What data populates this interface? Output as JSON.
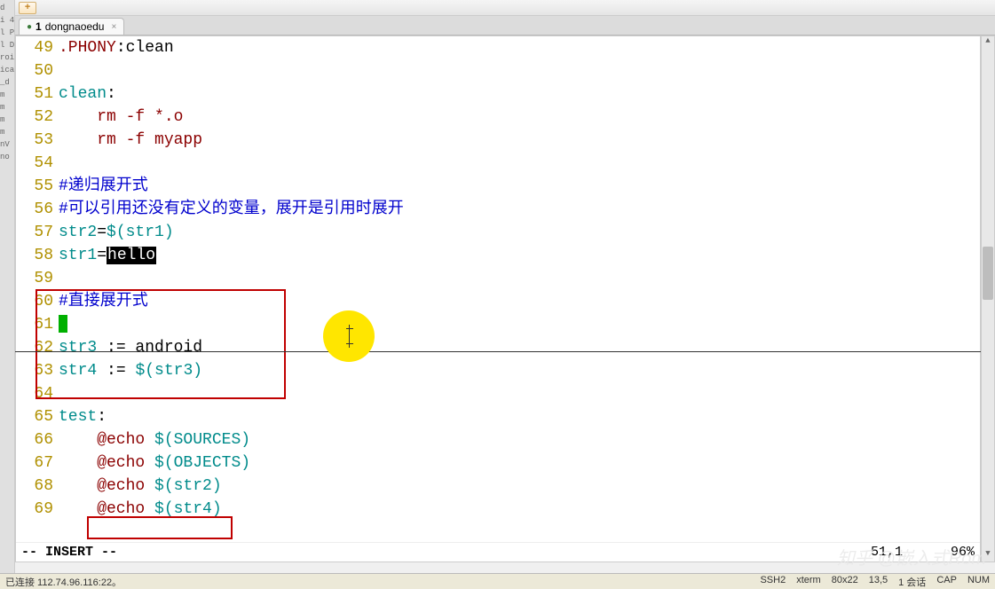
{
  "sidebar": {
    "items": [
      "",
      "d",
      "",
      "i 4",
      "l P",
      "l D",
      "",
      "roi",
      "ica",
      "_d",
      "m",
      "m",
      "m",
      "m",
      "nV",
      "no"
    ]
  },
  "topbar": {
    "add_label": "+"
  },
  "tab": {
    "index": "1",
    "title": "dongnaoedu",
    "close": "×"
  },
  "code": {
    "lines": [
      {
        "num": "49",
        "segments": [
          {
            "t": ".PHONY",
            "c": "c-brown"
          },
          {
            "t": ":clean",
            "c": ""
          }
        ]
      },
      {
        "num": "50",
        "segments": []
      },
      {
        "num": "51",
        "segments": [
          {
            "t": "clean",
            "c": "c-teal"
          },
          {
            "t": ":",
            "c": ""
          }
        ]
      },
      {
        "num": "52",
        "segments": [
          {
            "t": "    rm -f *.o",
            "c": "c-brown"
          }
        ]
      },
      {
        "num": "53",
        "segments": [
          {
            "t": "    rm -f myapp",
            "c": "c-brown"
          }
        ]
      },
      {
        "num": "54",
        "segments": []
      },
      {
        "num": "55",
        "segments": [
          {
            "t": "#递归展开式",
            "c": "c-blue"
          }
        ]
      },
      {
        "num": "56",
        "segments": [
          {
            "t": "#可以引用还没有定义的变量，展开是引用时展开",
            "c": "c-blue"
          }
        ]
      },
      {
        "num": "57",
        "segments": [
          {
            "t": "str2",
            "c": "c-teal"
          },
          {
            "t": "=",
            "c": ""
          },
          {
            "t": "$(str1)",
            "c": "c-teal"
          }
        ]
      },
      {
        "num": "58",
        "segments": [
          {
            "t": "str1",
            "c": "c-teal"
          },
          {
            "t": "=",
            "c": ""
          },
          {
            "t": "hello",
            "c": "c-str"
          }
        ]
      },
      {
        "num": "59",
        "segments": []
      },
      {
        "num": "60",
        "segments": [
          {
            "t": "#直接展开式",
            "c": "c-blue"
          }
        ]
      },
      {
        "num": "61",
        "segments": [
          {
            "t": "",
            "c": "",
            "cursor": true
          }
        ]
      },
      {
        "num": "62",
        "segments": [
          {
            "t": "str3",
            "c": "c-teal"
          },
          {
            "t": " := android",
            "c": ""
          }
        ]
      },
      {
        "num": "63",
        "segments": [
          {
            "t": "str4",
            "c": "c-teal"
          },
          {
            "t": " := ",
            "c": ""
          },
          {
            "t": "$(str3)",
            "c": "c-teal"
          }
        ]
      },
      {
        "num": "64",
        "segments": []
      },
      {
        "num": "65",
        "segments": [
          {
            "t": "test",
            "c": "c-teal"
          },
          {
            "t": ":",
            "c": ""
          }
        ]
      },
      {
        "num": "66",
        "segments": [
          {
            "t": "    @echo ",
            "c": "c-brown"
          },
          {
            "t": "$(SOURCES)",
            "c": "c-teal"
          }
        ]
      },
      {
        "num": "67",
        "segments": [
          {
            "t": "    @echo ",
            "c": "c-brown"
          },
          {
            "t": "$(OBJECTS)",
            "c": "c-teal"
          }
        ]
      },
      {
        "num": "68",
        "segments": [
          {
            "t": "    @echo ",
            "c": "c-brown"
          },
          {
            "t": "$(str2)",
            "c": "c-teal"
          }
        ]
      },
      {
        "num": "69",
        "segments": [
          {
            "t": "    @echo ",
            "c": "c-brown"
          },
          {
            "t": "$(str4)",
            "c": "c-teal"
          }
        ]
      }
    ]
  },
  "status": {
    "mode": "-- INSERT --",
    "pos": "51,1",
    "pct": "96%"
  },
  "bottom": {
    "left": "已连接 112.74.96.116:22。",
    "ssh": "SSH2",
    "term": "xterm",
    "size": "80x22",
    "rows": "13,5",
    "sess": "1 会话",
    "caps": "CAP",
    "num": "NUM"
  },
  "watermark": "知乎 @嵌入式Rom"
}
